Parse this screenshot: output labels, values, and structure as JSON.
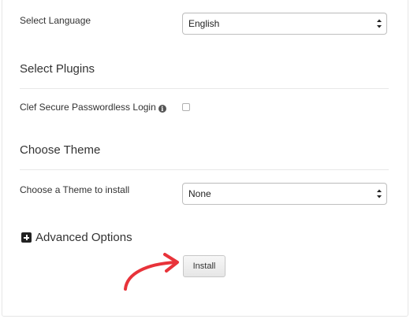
{
  "language": {
    "label": "Select Language",
    "selected": "English"
  },
  "plugins": {
    "title": "Select Plugins",
    "clef_label": "Clef Secure Passwordless Login",
    "info_glyph": "i"
  },
  "theme": {
    "title": "Choose Theme",
    "label": "Choose a Theme to install",
    "selected": "None"
  },
  "advanced": {
    "label": "Advanced Options"
  },
  "install": {
    "label": "Install"
  },
  "colors": {
    "annotation_arrow": "#e8333a"
  }
}
